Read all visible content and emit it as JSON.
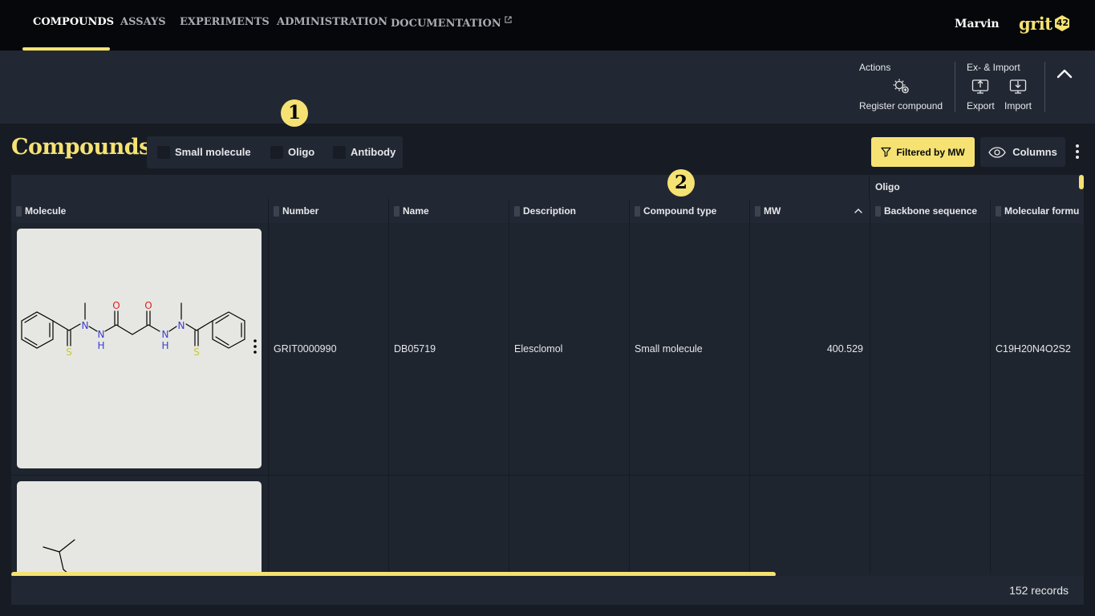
{
  "nav": {
    "items": [
      {
        "label": "COMPOUNDS",
        "active": true
      },
      {
        "label": "ASSAYS"
      },
      {
        "label": "EXPERIMENTS"
      },
      {
        "label": "ADMINISTRATION"
      },
      {
        "label": "DOCUMENTATION",
        "external_icon": "external-link-icon"
      }
    ],
    "user": "Marvin",
    "logo_text": "grit",
    "logo_badge": "42"
  },
  "toolbar": {
    "actions_label": "Actions",
    "register_label": "Register compound",
    "eximport_label": "Ex- & Import",
    "export_label": "Export",
    "import_label": "Import",
    "icons": {
      "register": "register-compound-icon",
      "export": "export-icon",
      "import": "import-icon",
      "collapse": "chevron-up-icon"
    }
  },
  "header": {
    "title": "Compounds",
    "type_filters": [
      "Small molecule",
      "Oligo",
      "Antibody"
    ],
    "filter_button": "Filtered by MW",
    "columns_button": "Columns",
    "markers": [
      "1",
      "2"
    ]
  },
  "table": {
    "group_header": "Oligo",
    "columns": [
      "Molecule",
      "Number",
      "Name",
      "Description",
      "Compound type",
      "MW",
      "Backbone sequence",
      "Molecular formu"
    ],
    "sort": {
      "column": "MW",
      "direction": "ascending"
    },
    "rows": [
      {
        "number": "GRIT0000990",
        "name": "DB05719",
        "description": "Elesclomol",
        "compound_type": "Small molecule",
        "mw": "400.529",
        "backbone_sequence": "",
        "molecular_formula": "C19H20N4O2S2"
      },
      {
        "number": "",
        "name": "",
        "description": "",
        "compound_type": "",
        "mw": "",
        "backbone_sequence": "",
        "molecular_formula": ""
      }
    ],
    "atom_labels": {
      "n": "N",
      "h": "H",
      "o": "O",
      "s": "S"
    },
    "records": "152 records"
  },
  "colors": {
    "accent": "#f5e272",
    "nav_bg": "#06070a",
    "panel": "#222833",
    "grid": "#1f252f",
    "nitrogen": "#3a3ad8",
    "oxygen": "#e02020",
    "sulfur": "#c8c83a"
  }
}
